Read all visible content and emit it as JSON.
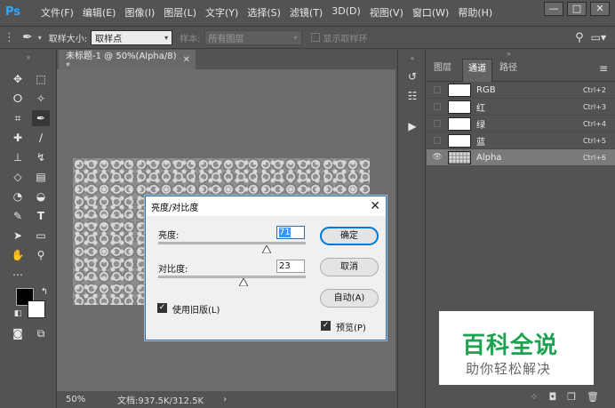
{
  "app": {
    "logo": "Ps",
    "menus": [
      "文件(F)",
      "编辑(E)",
      "图像(I)",
      "图层(L)",
      "文字(Y)",
      "选择(S)",
      "滤镜(T)",
      "3D(D)",
      "视图(V)",
      "窗口(W)",
      "帮助(H)"
    ],
    "window_controls": {
      "minimize": "—",
      "maximize": "□",
      "close": "✕"
    }
  },
  "options_bar": {
    "sample_size_label": "取样大小:",
    "sample_size_value": "取样点",
    "sample_label": "样本:",
    "sample_value": "所有图层",
    "show_ring_label": "显示取样环"
  },
  "document": {
    "tab_title": "未标题-1 @ 50%(Alpha/8) *",
    "tab_close": "✕",
    "zoom": "50%",
    "doc_size": "文档:937.5K/312.5K",
    "status_arrow": "›"
  },
  "channels_panel": {
    "tabs": [
      "图层",
      "通道",
      "路径"
    ],
    "active_tab": "通道",
    "menu_icon": "≡",
    "channels": [
      {
        "name": "RGB",
        "shortcut": "Ctrl+2",
        "visible": false,
        "selected": false
      },
      {
        "name": "红",
        "shortcut": "Ctrl+3",
        "visible": false,
        "selected": false
      },
      {
        "name": "绿",
        "shortcut": "Ctrl+4",
        "visible": false,
        "selected": false
      },
      {
        "name": "蓝",
        "shortcut": "Ctrl+5",
        "visible": false,
        "selected": false
      },
      {
        "name": "Alpha",
        "shortcut": "Ctrl+6",
        "visible": true,
        "selected": true
      }
    ]
  },
  "dialog": {
    "title": "亮度/对比度",
    "close": "✕",
    "brightness_label": "亮度:",
    "brightness_value": "71",
    "brightness": 71,
    "contrast_label": "对比度:",
    "contrast_value": "23",
    "contrast": 23,
    "slider_min": -150,
    "slider_max": 150,
    "use_legacy_label": "使用旧版(L)",
    "use_legacy_checked": true,
    "preview_label": "预览(P)",
    "preview_checked": true,
    "ok_button": "确定",
    "cancel_button": "取消",
    "auto_button": "自动(A)"
  },
  "watermark": {
    "logo_text": "百科全说",
    "subtitle": "助你轻松解决"
  },
  "colors": {
    "accent": "#31a8ff",
    "foreground_swatch": "#000000",
    "background_swatch": "#ffffff",
    "watermark_green": "#1da350"
  }
}
